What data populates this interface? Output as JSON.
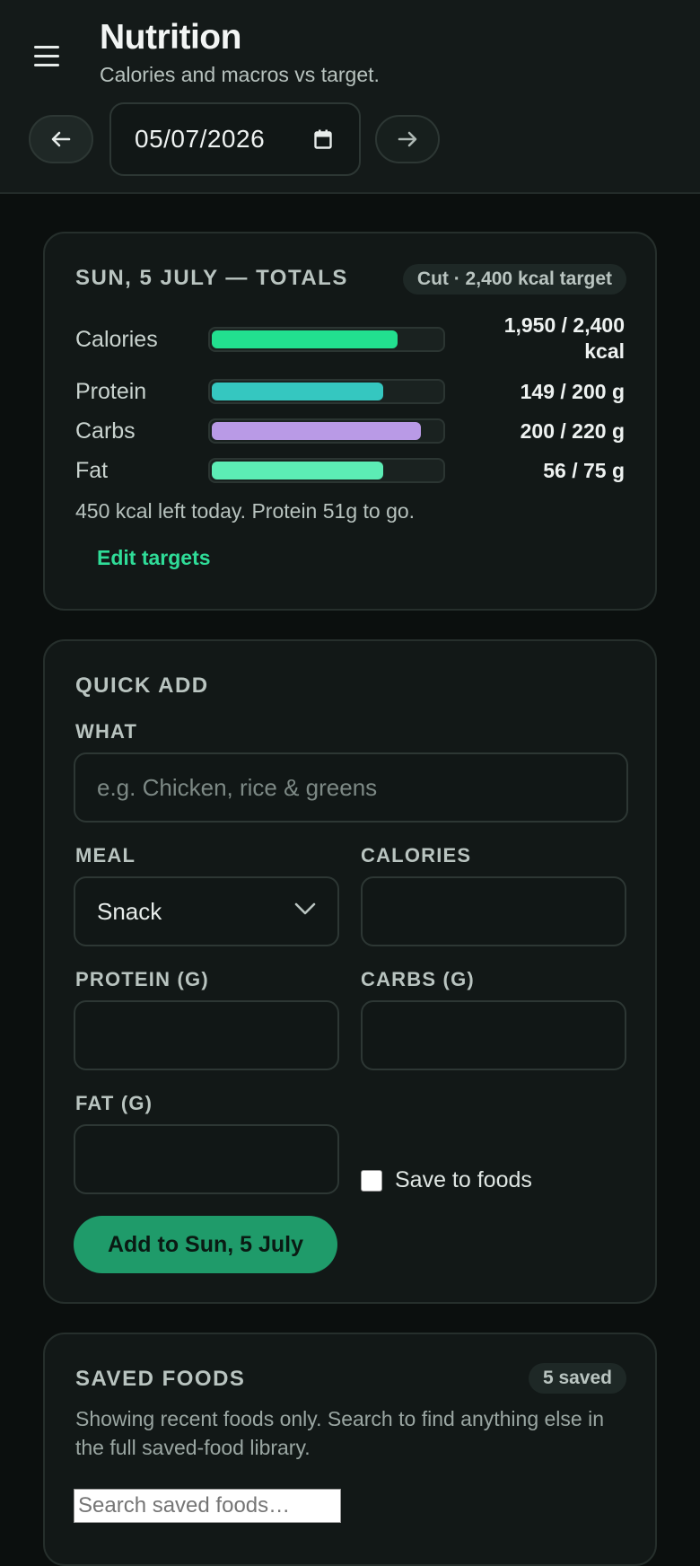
{
  "header": {
    "title": "Nutrition",
    "subtitle": "Calories and macros vs target.",
    "date_value": "05/07/2026",
    "prev_icon": "arrow-left-icon",
    "next_icon": "arrow-right-icon"
  },
  "totals": {
    "heading": "SUN, 5 JULY — TOTALS",
    "plan_badge": "Cut · 2,400 kcal target",
    "rows": [
      {
        "label": "Calories",
        "value_line1": "1,950 / 2,400",
        "value_line2": "kcal",
        "consumed": 1950,
        "target": 2400,
        "fill_fraction": 0.81,
        "color": "#22e08f"
      },
      {
        "label": "Protein",
        "value_line1": "149 / 200 g",
        "value_line2": "",
        "consumed": 149,
        "target": 200,
        "fill_fraction": 0.745,
        "color": "#35c7c0"
      },
      {
        "label": "Carbs",
        "value_line1": "200 / 220 g",
        "value_line2": "",
        "consumed": 200,
        "target": 220,
        "fill_fraction": 0.91,
        "color": "#b99ae6"
      },
      {
        "label": "Fat",
        "value_line1": "56 / 75 g",
        "value_line2": "",
        "consumed": 56,
        "target": 75,
        "fill_fraction": 0.747,
        "color": "#5cedb5"
      }
    ],
    "summary": "450 kcal left today. Protein 51g to go.",
    "edit_link": "Edit targets"
  },
  "quick_add": {
    "heading": "QUICK ADD",
    "what_label": "WHAT",
    "what_placeholder": "e.g. Chicken, rice & greens",
    "meal_label": "MEAL",
    "meal_value": "Snack",
    "calories_label": "CALORIES",
    "protein_label": "PROTEIN (G)",
    "carbs_label": "CARBS (G)",
    "fat_label": "FAT (G)",
    "save_to_foods_label": "Save to foods",
    "save_to_foods_checked": false,
    "submit_label": "Add to Sun, 5 July"
  },
  "saved_foods": {
    "heading": "SAVED FOODS",
    "count_badge": "5 saved",
    "description": "Showing recent foods only. Search to find anything else in the full saved-food library.",
    "search_placeholder": "Search saved foods…"
  },
  "colors": {
    "accent": "#2fdc98",
    "primary_button": "#1f9b6a",
    "background": "#0b0f0e",
    "card": "#121817"
  }
}
